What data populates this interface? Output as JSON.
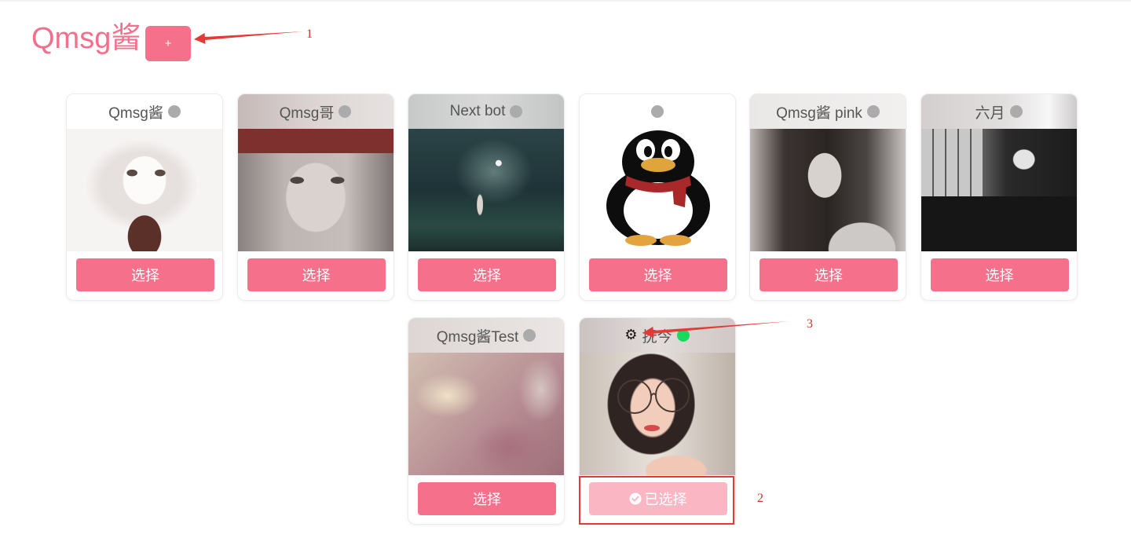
{
  "app": {
    "title": "Qmsg酱",
    "add_button_label": "+"
  },
  "theme": {
    "accent": "#f5708a",
    "accent_selected": "#fbb6c4",
    "title_color": "#f2708c",
    "offline_dot": "#ababab",
    "online_dot": "#1ed760",
    "annotation": "#e53935"
  },
  "cards": [
    {
      "name": "Qmsg酱",
      "online": false,
      "selected": false,
      "button_label": "选择"
    },
    {
      "name": "Qmsg哥",
      "online": false,
      "selected": false,
      "button_label": "选择"
    },
    {
      "name": "Next bot",
      "online": false,
      "selected": false,
      "button_label": "选择"
    },
    {
      "name": "",
      "online": false,
      "selected": false,
      "button_label": "选择"
    },
    {
      "name": "Qmsg酱 pink",
      "online": false,
      "selected": false,
      "button_label": "选择"
    },
    {
      "name": "六月",
      "online": false,
      "selected": false,
      "button_label": "选择"
    },
    {
      "name": "Qmsg酱Test",
      "online": false,
      "selected": false,
      "button_label": "选择"
    },
    {
      "name": "抚今",
      "online": true,
      "selected": true,
      "button_label": "已选择",
      "settings_icon": "gear-icon",
      "selected_icon": "check-circle-icon"
    }
  ],
  "annotations": [
    {
      "label": "1"
    },
    {
      "label": "2"
    },
    {
      "label": "3"
    }
  ]
}
